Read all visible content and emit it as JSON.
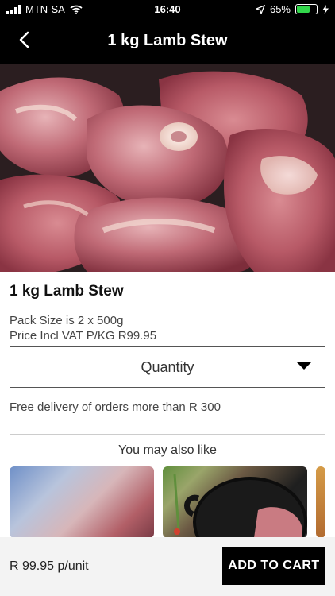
{
  "status_bar": {
    "carrier": "MTN-SA",
    "time": "16:40",
    "battery_percent": "65%"
  },
  "header": {
    "title": "1 kg Lamb Stew"
  },
  "product": {
    "name": "1 kg Lamb Stew",
    "pack_size": "Pack Size is 2 x 500g",
    "price_line": "Price Incl VAT P/KG R99.95"
  },
  "quantity": {
    "label": "Quantity"
  },
  "delivery_note": "Free delivery of orders more than R 300",
  "recommendations": {
    "heading": "You may also like"
  },
  "footer": {
    "price_per_unit": "R 99.95 p/unit",
    "add_to_cart_label": "ADD TO CART"
  },
  "colors": {
    "header_bg": "#000000",
    "button_bg": "#000000",
    "battery_green": "#32d74b"
  },
  "icons": {
    "back": "chevron-left-icon",
    "dropdown": "caret-down-icon",
    "wifi": "wifi-icon",
    "location": "location-arrow-icon",
    "charging": "bolt-icon"
  }
}
